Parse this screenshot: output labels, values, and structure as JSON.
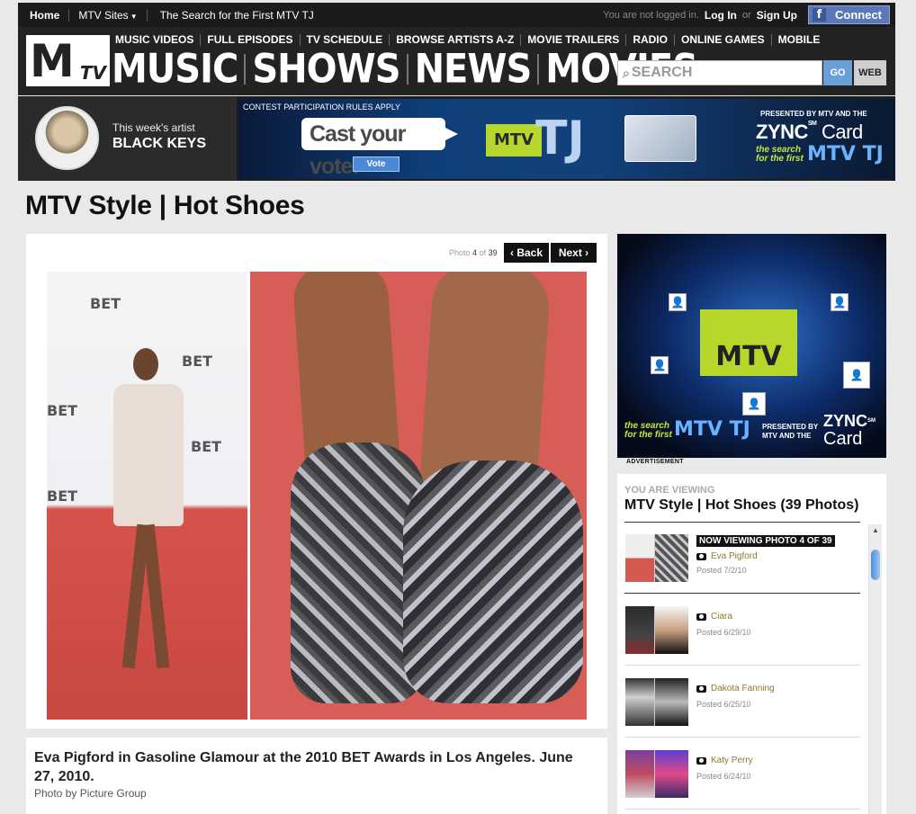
{
  "topbar": {
    "home": "Home",
    "sites": "MTV Sites",
    "promo": "The Search for the First MTV TJ",
    "not_logged": "You are not logged in.",
    "login": "Log In",
    "or": "or",
    "signup": "Sign Up",
    "connect": "Connect"
  },
  "header": {
    "logo_m": "M",
    "logo_tv": "TV",
    "subnav": [
      "MUSIC VIDEOS",
      "FULL EPISODES",
      "TV SCHEDULE",
      "BROWSE ARTISTS A-Z",
      "MOVIE TRAILERS",
      "RADIO",
      "ONLINE GAMES",
      "MOBILE"
    ],
    "bignav": [
      "MUSIC",
      "SHOWS",
      "NEWS",
      "MOVIES"
    ],
    "search_placeholder": "SEARCH",
    "go": "GO",
    "web": "WEB"
  },
  "promo": {
    "artist_kicker": "This week's artist",
    "artist_name": "BLACK KEYS",
    "rules": "CONTEST PARTICIPATION RULES APPLY",
    "cast_vote": "Cast your vote!",
    "vote": "Vote",
    "presented": "PRESENTED BY MTV AND THE",
    "zync": "ZYNC",
    "sm": "SM",
    "card": "Card",
    "search_for": "the search",
    "search_for2": "for the first",
    "mtvtj": "MTV TJ"
  },
  "page_title": "MTV Style | Hot Shoes",
  "gallery": {
    "photo_word": "Photo",
    "current": "4",
    "of_word": "of",
    "total": "39",
    "back": "Back",
    "next": "Next",
    "caption": "Eva Pigford in Gasoline Glamour at the 2010 BET Awards in Los Angeles. June 27, 2010.",
    "credit": "Photo by Picture Group"
  },
  "ad": {
    "mtv": "MTV",
    "label": "ADVERTISEMENT",
    "search_for": "the search",
    "search_for2": "for the first",
    "mtvtj": "MTV TJ",
    "presented": "PRESENTED BY",
    "presented2": "MTV AND THE",
    "zync": "ZYNC",
    "sm": "SM",
    "card": "Card"
  },
  "viewing": {
    "kicker": "YOU ARE VIEWING",
    "title": "MTV Style | Hot Shoes (39 Photos)",
    "now_viewing": "NOW VIEWING PHOTO 4 OF 39",
    "items": [
      {
        "name": "Eva Pigford",
        "date": "Posted 7/2/10"
      },
      {
        "name": "Ciara",
        "date": "Posted 6/29/10"
      },
      {
        "name": "Dakota Fanning",
        "date": "Posted 6/25/10"
      },
      {
        "name": "Katy Perry",
        "date": "Posted 6/24/10"
      }
    ]
  },
  "colors": {
    "accent_blue": "#6aa0d8",
    "mtv_green": "#b7d72c",
    "link_gold": "#8b7a2a",
    "facebook": "#5b77b7"
  }
}
